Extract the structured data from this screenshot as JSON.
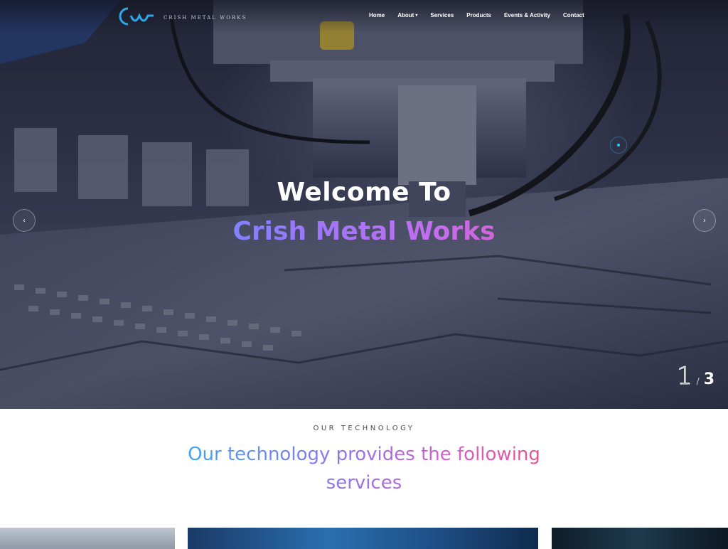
{
  "header": {
    "brand_name": "CRISH METAL WORKS",
    "nav": [
      {
        "label": "Home"
      },
      {
        "label": "About",
        "has_dropdown": true
      },
      {
        "label": "Services"
      },
      {
        "label": "Products"
      },
      {
        "label": "Events & Activity"
      },
      {
        "label": "Contact"
      }
    ]
  },
  "hero": {
    "title": "Welcome To",
    "subtitle": "Crish Metal Works",
    "counter_current": "1",
    "counter_separator": "/",
    "counter_total": "3",
    "accent": "#2bd0ff"
  },
  "technology": {
    "eyebrow": "OUR TECHNOLOGY",
    "heading": "Our technology provides the following services"
  },
  "icons": {
    "prev": "chevron-left-icon",
    "next": "chevron-right-icon",
    "dropdown": "caret-down-icon",
    "logo": "cmw-logo-icon"
  },
  "colors": {
    "gradient_start": "#2bb9ff",
    "gradient_mid": "#8a7cff",
    "gradient_end": "#ff4f7a"
  }
}
